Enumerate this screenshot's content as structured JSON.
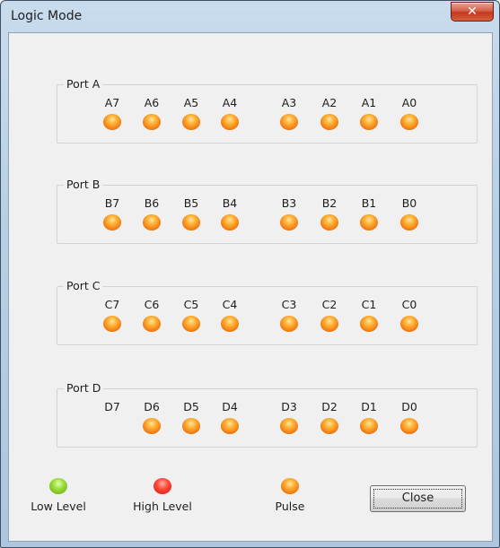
{
  "window": {
    "title": "Logic Mode",
    "close_glyph": "✕"
  },
  "ports": [
    {
      "label": "Port A",
      "pins": [
        {
          "name": "A7",
          "led": "pulse"
        },
        {
          "name": "A6",
          "led": "pulse"
        },
        {
          "name": "A5",
          "led": "pulse"
        },
        {
          "name": "A4",
          "led": "pulse"
        },
        {
          "name": "A3",
          "led": "pulse"
        },
        {
          "name": "A2",
          "led": "pulse"
        },
        {
          "name": "A1",
          "led": "pulse"
        },
        {
          "name": "A0",
          "led": "pulse"
        }
      ]
    },
    {
      "label": "Port B",
      "pins": [
        {
          "name": "B7",
          "led": "pulse"
        },
        {
          "name": "B6",
          "led": "pulse"
        },
        {
          "name": "B5",
          "led": "pulse"
        },
        {
          "name": "B4",
          "led": "pulse"
        },
        {
          "name": "B3",
          "led": "pulse"
        },
        {
          "name": "B2",
          "led": "pulse"
        },
        {
          "name": "B1",
          "led": "pulse"
        },
        {
          "name": "B0",
          "led": "pulse"
        }
      ]
    },
    {
      "label": "Port C",
      "pins": [
        {
          "name": "C7",
          "led": "pulse"
        },
        {
          "name": "C6",
          "led": "pulse"
        },
        {
          "name": "C5",
          "led": "pulse"
        },
        {
          "name": "C4",
          "led": "pulse"
        },
        {
          "name": "C3",
          "led": "pulse"
        },
        {
          "name": "C2",
          "led": "pulse"
        },
        {
          "name": "C1",
          "led": "pulse"
        },
        {
          "name": "C0",
          "led": "pulse"
        }
      ]
    },
    {
      "label": "Port D",
      "pins": [
        {
          "name": "D7",
          "led": "none"
        },
        {
          "name": "D6",
          "led": "pulse"
        },
        {
          "name": "D5",
          "led": "pulse"
        },
        {
          "name": "D4",
          "led": "pulse"
        },
        {
          "name": "D3",
          "led": "pulse"
        },
        {
          "name": "D2",
          "led": "pulse"
        },
        {
          "name": "D1",
          "led": "pulse"
        },
        {
          "name": "D0",
          "led": "pulse"
        }
      ]
    }
  ],
  "legend": [
    {
      "label": "Low Level",
      "led": "low"
    },
    {
      "label": "High Level",
      "led": "high"
    },
    {
      "label": "Pulse",
      "led": "pulse"
    }
  ],
  "close_button": {
    "label": "Close"
  },
  "colors": {
    "pulse": "#f08a1c",
    "low": "#7cc41f",
    "high": "#e8281a",
    "close_x": "#c7432c"
  }
}
